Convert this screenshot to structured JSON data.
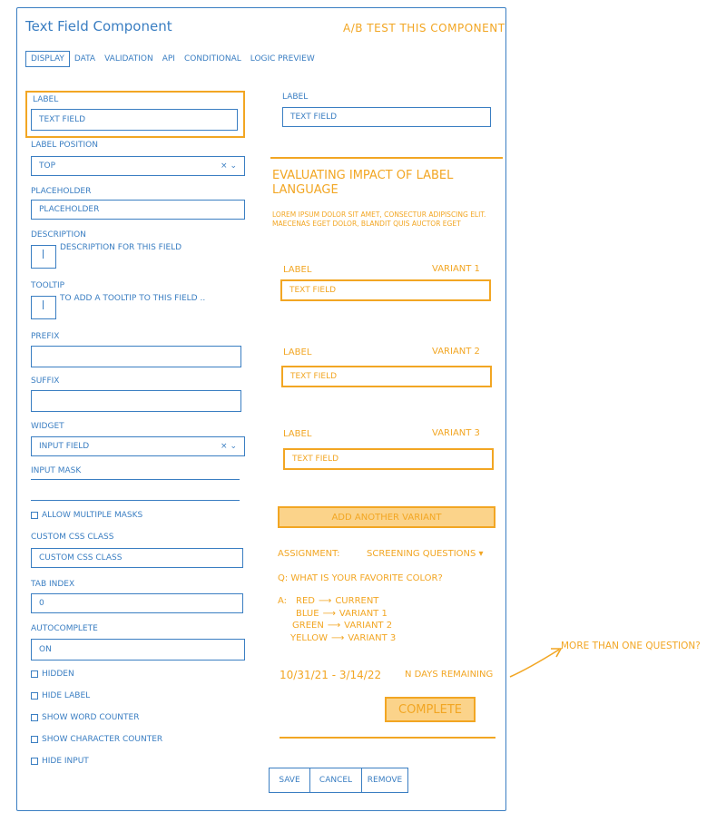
{
  "title": "Text Field Component",
  "ab_test_link": "A/B TEST THIS COMPONENT",
  "tabs": [
    "DISPLAY",
    "DATA",
    "VALIDATION",
    "API",
    "CONDITIONAL",
    "LOGIC"
  ],
  "preview_label": "PREVIEW",
  "form": {
    "label": {
      "label": "LABEL",
      "value": "TEXT FIELD"
    },
    "label_position": {
      "label": "LABEL POSITION",
      "value": "TOP",
      "ctrl": "× ⌄"
    },
    "placeholder": {
      "label": "PLACEHOLDER",
      "value": "PLACEHOLDER"
    },
    "description": {
      "label": "DESCRIPTION",
      "hint": "DESCRIPTION FOR THIS FIELD"
    },
    "tooltip": {
      "label": "TOOLTIP",
      "hint": "TO ADD A TOOLTIP TO THIS FIELD .."
    },
    "prefix": {
      "label": "PREFIX"
    },
    "suffix": {
      "label": "SUFFIX"
    },
    "widget": {
      "label": "WIDGET",
      "value": "INPUT FIELD",
      "ctrl": "× ⌄"
    },
    "input_mask": {
      "label": "INPUT MASK"
    },
    "allow_multiple_masks": "ALLOW MULTIPLE MASKS",
    "custom_css": {
      "label": "CUSTOM CSS CLASS",
      "value": "CUSTOM CSS CLASS"
    },
    "tab_index": {
      "label": "TAB INDEX",
      "value": "0"
    },
    "autocomplete": {
      "label": "AUTOCOMPLETE",
      "value": "ON"
    },
    "hidden": "HIDDEN",
    "hide_label": "HIDE LABEL",
    "show_word_counter": "SHOW WORD COUNTER",
    "show_character_counter": "SHOW CHARACTER COUNTER",
    "hide_input": "HIDE INPUT"
  },
  "preview": {
    "label": "LABEL",
    "value": "TEXT FIELD"
  },
  "ab": {
    "heading": "EVALUATING IMPACT OF LABEL LANGUAGE",
    "body": "LOREM IPSUM DOLOR SIT AMET, CONSECTUR ADIPISCING ELIT. MAECENAS EGET DOLOR, BLANDIT QUIS AUCTOR EGET",
    "variants": [
      {
        "label": "LABEL",
        "tag": "VARIANT 1",
        "value": "TEXT FIELD"
      },
      {
        "label": "LABEL",
        "tag": "VARIANT 2",
        "value": "TEXT FIELD"
      },
      {
        "label": "LABEL",
        "tag": "VARIANT 3",
        "value": "TEXT FIELD"
      }
    ],
    "add_variant": "ADD ANOTHER VARIANT",
    "assignment_label": "ASSIGNMENT:",
    "assignment_value": "SCREENING QUESTIONS ▾",
    "question": "Q: WHAT IS YOUR FAVORITE COLOR?",
    "answer_prefix": "A:",
    "mapping": [
      {
        "answer": "RED",
        "target": "CURRENT"
      },
      {
        "answer": "BLUE",
        "target": "VARIANT 1"
      },
      {
        "answer": "GREEN",
        "target": "VARIANT 2"
      },
      {
        "answer": "YELLOW",
        "target": "VARIANT 3"
      }
    ],
    "arrow": "⟶",
    "dates": "10/31/21 - 3/14/22",
    "remaining": "N DAYS REMAINING",
    "complete": "COMPLETE",
    "note": "MORE THAN ONE QUESTION?"
  },
  "footer": {
    "save": "SAVE",
    "cancel": "CANCEL",
    "remove": "REMOVE"
  },
  "colors": {
    "primary": "#3a7ec2",
    "accent": "#f2a623",
    "accent_fill": "#fbd38a"
  }
}
